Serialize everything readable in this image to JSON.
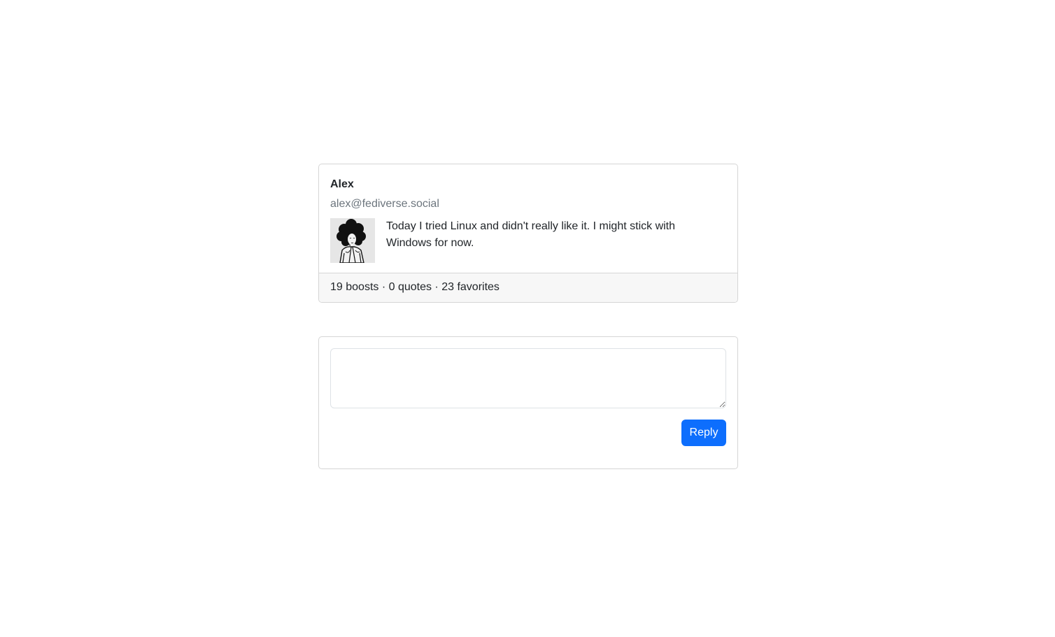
{
  "post": {
    "author_name": "Alex",
    "author_handle": "alex@fediverse.social",
    "avatar_icon": "person-avatar-icon",
    "text": "Today I tried Linux and didn't really like it. I might stick with Windows for now.",
    "stats": "19 boosts · 0 quotes · 23 favorites"
  },
  "reply": {
    "textarea_value": "",
    "textarea_placeholder": "",
    "button_label": "Reply"
  },
  "colors": {
    "primary": "#0d6efd",
    "border": "#d5d5d5",
    "footer_bg": "#f7f7f7",
    "muted_text": "#6c757d"
  }
}
